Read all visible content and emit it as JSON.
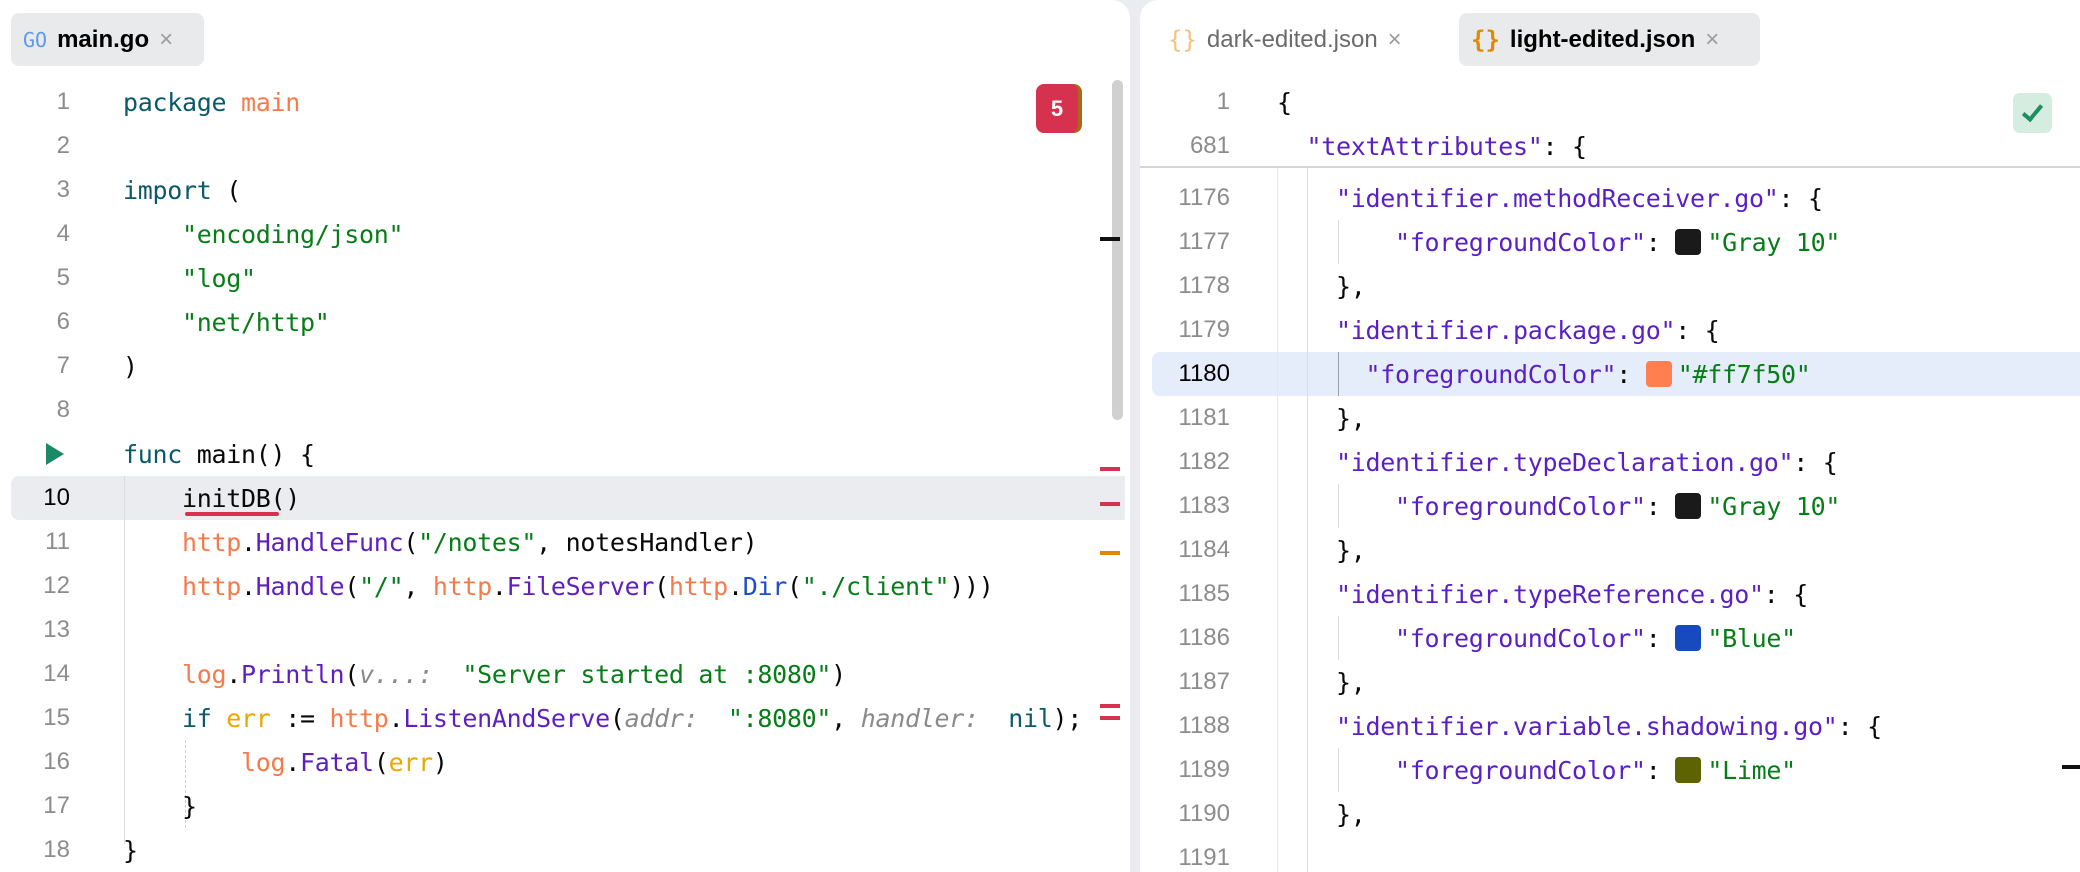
{
  "left": {
    "tab": {
      "icon": "GO",
      "label": "main.go",
      "close": "×"
    },
    "problems_count": "5",
    "current_line": 10,
    "lines": [
      [
        [
          "kw",
          "package "
        ],
        [
          "pkg",
          "main"
        ]
      ],
      [],
      [
        [
          "kw",
          "import "
        ],
        [
          "plain",
          "("
        ]
      ],
      [
        [
          "str",
          "    \"encoding/json\""
        ]
      ],
      [
        [
          "str",
          "    \"log\""
        ]
      ],
      [
        [
          "str",
          "    \"net/http\""
        ]
      ],
      [
        [
          "plain",
          ")"
        ]
      ],
      [],
      [
        [
          "kw",
          "func "
        ],
        [
          "plain",
          "main() {"
        ]
      ],
      [
        [
          "plain",
          "    initDB()"
        ]
      ],
      [
        [
          "plain",
          "    "
        ],
        [
          "pkg",
          "http"
        ],
        [
          "plain",
          "."
        ],
        [
          "fn",
          "HandleFunc"
        ],
        [
          "plain",
          "("
        ],
        [
          "str",
          "\"/notes\""
        ],
        [
          "plain",
          ", notesHandler)"
        ]
      ],
      [
        [
          "plain",
          "    "
        ],
        [
          "pkg",
          "http"
        ],
        [
          "plain",
          "."
        ],
        [
          "fn",
          "Handle"
        ],
        [
          "plain",
          "("
        ],
        [
          "str",
          "\"/\""
        ],
        [
          "plain",
          ", "
        ],
        [
          "pkg",
          "http"
        ],
        [
          "plain",
          "."
        ],
        [
          "fn",
          "FileServer"
        ],
        [
          "plain",
          "("
        ],
        [
          "pkg",
          "http"
        ],
        [
          "plain",
          "."
        ],
        [
          "typ",
          "Dir"
        ],
        [
          "plain",
          "("
        ],
        [
          "str",
          "\"./client\""
        ],
        [
          "plain",
          ")))"
        ]
      ],
      [],
      [
        [
          "plain",
          "    "
        ],
        [
          "pkg",
          "log"
        ],
        [
          "plain",
          "."
        ],
        [
          "fn",
          "Println"
        ],
        [
          "plain",
          "("
        ],
        [
          "hint",
          "v...: "
        ],
        [
          "plain",
          " "
        ],
        [
          "str",
          "\"Server started at :8080\""
        ],
        [
          "plain",
          ")"
        ]
      ],
      [
        [
          "kw",
          "    if "
        ],
        [
          "var",
          "err"
        ],
        [
          "plain",
          " := "
        ],
        [
          "pkg",
          "http"
        ],
        [
          "plain",
          "."
        ],
        [
          "fn",
          "ListenAndServe"
        ],
        [
          "plain",
          "("
        ],
        [
          "hint",
          "addr: "
        ],
        [
          "plain",
          " "
        ],
        [
          "str",
          "\":8080\""
        ],
        [
          "plain",
          ", "
        ],
        [
          "hint",
          "handler: "
        ],
        [
          "plain",
          " "
        ],
        [
          "kw",
          "nil"
        ],
        [
          "plain",
          "); "
        ]
      ],
      [
        [
          "plain",
          "        "
        ],
        [
          "pkg",
          "log"
        ],
        [
          "plain",
          "."
        ],
        [
          "fn",
          "Fatal"
        ],
        [
          "plain",
          "("
        ],
        [
          "var",
          "err"
        ],
        [
          "plain",
          ")"
        ]
      ],
      [
        [
          "plain",
          "    }"
        ]
      ],
      [
        [
          "plain",
          "}"
        ]
      ]
    ]
  },
  "right": {
    "tabs": [
      {
        "label": "dark-edited.json",
        "icon": "{}",
        "close": "×"
      },
      {
        "label": "light-edited.json",
        "icon": "{}",
        "close": "×"
      }
    ],
    "sticky": [
      {
        "num": "1",
        "tokens": [
          [
            "plain",
            "{"
          ]
        ]
      },
      {
        "num": "681",
        "tokens": [
          [
            "key",
            "  \"textAttributes\""
          ],
          [
            "plain",
            ": {"
          ]
        ]
      }
    ],
    "current_line": "1180",
    "lines": [
      {
        "num": "1176",
        "tokens": [
          [
            "key",
            "    \"identifier.methodReceiver.go\""
          ],
          [
            "plain",
            ": {"
          ]
        ]
      },
      {
        "num": "1177",
        "nested": true,
        "tokens": [
          [
            "key",
            "        \"foregroundColor\""
          ],
          [
            "plain",
            ": "
          ],
          [
            "swatch",
            "#1a1a1a"
          ],
          [
            "str",
            "\"Gray 10\""
          ]
        ]
      },
      {
        "num": "1178",
        "tokens": [
          [
            "plain",
            "    },"
          ]
        ]
      },
      {
        "num": "1179",
        "tokens": [
          [
            "key",
            "    \"identifier.package.go\""
          ],
          [
            "plain",
            ": {"
          ]
        ]
      },
      {
        "num": "1180",
        "nested": true,
        "tokens": [
          [
            "key",
            "      \"foregroundColor\""
          ],
          [
            "plain",
            ": "
          ],
          [
            "swatch",
            "#ff7f50"
          ],
          [
            "str",
            "\"#ff7f50\""
          ]
        ]
      },
      {
        "num": "1181",
        "tokens": [
          [
            "plain",
            "    },"
          ]
        ]
      },
      {
        "num": "1182",
        "tokens": [
          [
            "key",
            "    \"identifier.typeDeclaration.go\""
          ],
          [
            "plain",
            ": {"
          ]
        ]
      },
      {
        "num": "1183",
        "nested": true,
        "tokens": [
          [
            "key",
            "        \"foregroundColor\""
          ],
          [
            "plain",
            ": "
          ],
          [
            "swatch",
            "#1a1a1a"
          ],
          [
            "str",
            "\"Gray 10\""
          ]
        ]
      },
      {
        "num": "1184",
        "tokens": [
          [
            "plain",
            "    },"
          ]
        ]
      },
      {
        "num": "1185",
        "tokens": [
          [
            "key",
            "    \"identifier.typeReference.go\""
          ],
          [
            "plain",
            ": {"
          ]
        ]
      },
      {
        "num": "1186",
        "nested": true,
        "tokens": [
          [
            "key",
            "        \"foregroundColor\""
          ],
          [
            "plain",
            ": "
          ],
          [
            "swatch",
            "#164bbf"
          ],
          [
            "str",
            "\"Blue\""
          ]
        ]
      },
      {
        "num": "1187",
        "tokens": [
          [
            "plain",
            "    },"
          ]
        ]
      },
      {
        "num": "1188",
        "tokens": [
          [
            "key",
            "    \"identifier.variable.shadowing.go\""
          ],
          [
            "plain",
            ": {"
          ]
        ]
      },
      {
        "num": "1189",
        "nested": true,
        "tokens": [
          [
            "key",
            "        \"foregroundColor\""
          ],
          [
            "plain",
            ": "
          ],
          [
            "swatch",
            "#5c6300"
          ],
          [
            "str",
            "\"Lime\""
          ]
        ]
      },
      {
        "num": "1190",
        "tokens": [
          [
            "plain",
            "    },"
          ]
        ]
      },
      {
        "num": "1191",
        "tokens": []
      }
    ]
  },
  "colors": {
    "error": "#d6324f",
    "warning": "#e08a00",
    "ok_bg": "#d5ece0",
    "ok": "#1f8f5f",
    "current_line": "#ebecf0",
    "selected_line": "#e4edf9"
  }
}
